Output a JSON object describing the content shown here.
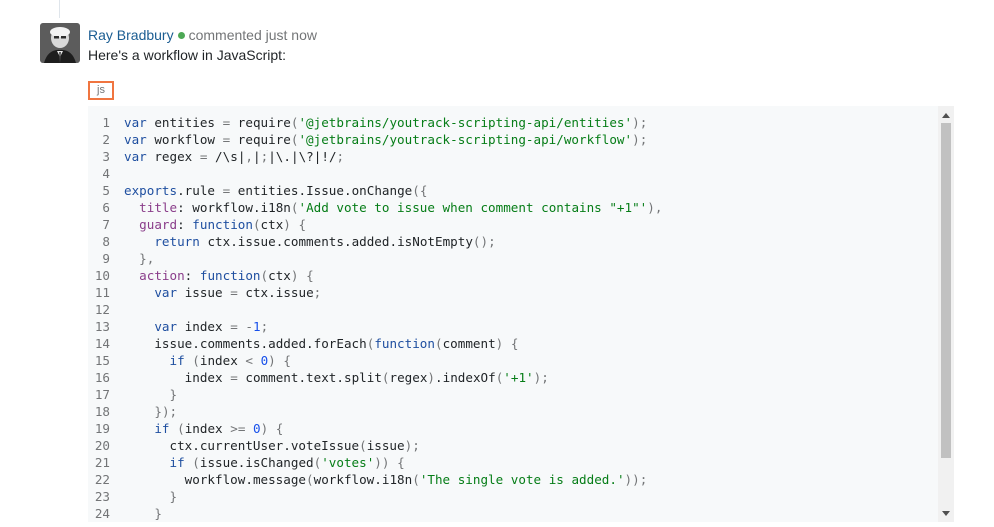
{
  "comment": {
    "author": "Ray Bradbury",
    "meta": "commented just now",
    "text": "Here's a workflow in JavaScript:",
    "online_status_color": "#4da855",
    "avatar_icon": "user-avatar"
  },
  "code": {
    "language": "js",
    "lines": [
      {
        "n": "1",
        "t": "var entities = require('@jetbrains/youtrack-scripting-api/entities');"
      },
      {
        "n": "2",
        "t": "var workflow = require('@jetbrains/youtrack-scripting-api/workflow');"
      },
      {
        "n": "3",
        "t": "var regex = /\\s|,|;|\\.|\\?|!/;"
      },
      {
        "n": "4",
        "t": ""
      },
      {
        "n": "5",
        "t": "exports.rule = entities.Issue.onChange({"
      },
      {
        "n": "6",
        "t": "  title: workflow.i18n('Add vote to issue when comment contains \"+1\"'),"
      },
      {
        "n": "7",
        "t": "  guard: function(ctx) {"
      },
      {
        "n": "8",
        "t": "    return ctx.issue.comments.added.isNotEmpty();"
      },
      {
        "n": "9",
        "t": "  },"
      },
      {
        "n": "10",
        "t": "  action: function(ctx) {"
      },
      {
        "n": "11",
        "t": "    var issue = ctx.issue;"
      },
      {
        "n": "12",
        "t": ""
      },
      {
        "n": "13",
        "t": "    var index = -1;"
      },
      {
        "n": "14",
        "t": "    issue.comments.added.forEach(function(comment) {"
      },
      {
        "n": "15",
        "t": "      if (index < 0) {"
      },
      {
        "n": "16",
        "t": "        index = comment.text.split(regex).indexOf('+1');"
      },
      {
        "n": "17",
        "t": "      }"
      },
      {
        "n": "18",
        "t": "    });"
      },
      {
        "n": "19",
        "t": "    if (index >= 0) {"
      },
      {
        "n": "20",
        "t": "      ctx.currentUser.voteIssue(issue);"
      },
      {
        "n": "21",
        "t": "      if (issue.isChanged('votes')) {"
      },
      {
        "n": "22",
        "t": "        workflow.message(workflow.i18n('The single vote is added.'));"
      },
      {
        "n": "23",
        "t": "      }"
      },
      {
        "n": "24",
        "t": "    }"
      }
    ]
  },
  "syntax_colors": {
    "keyword": "#1f4fa0",
    "string": "#067d17",
    "regex": "#067d17",
    "property": "#8a3d8a",
    "number": "#1750eb",
    "text": "#1f2326",
    "punct": "#737577"
  },
  "scrollbar": {
    "up_icon": "triangle-up-icon",
    "down_icon": "triangle-down-icon"
  }
}
